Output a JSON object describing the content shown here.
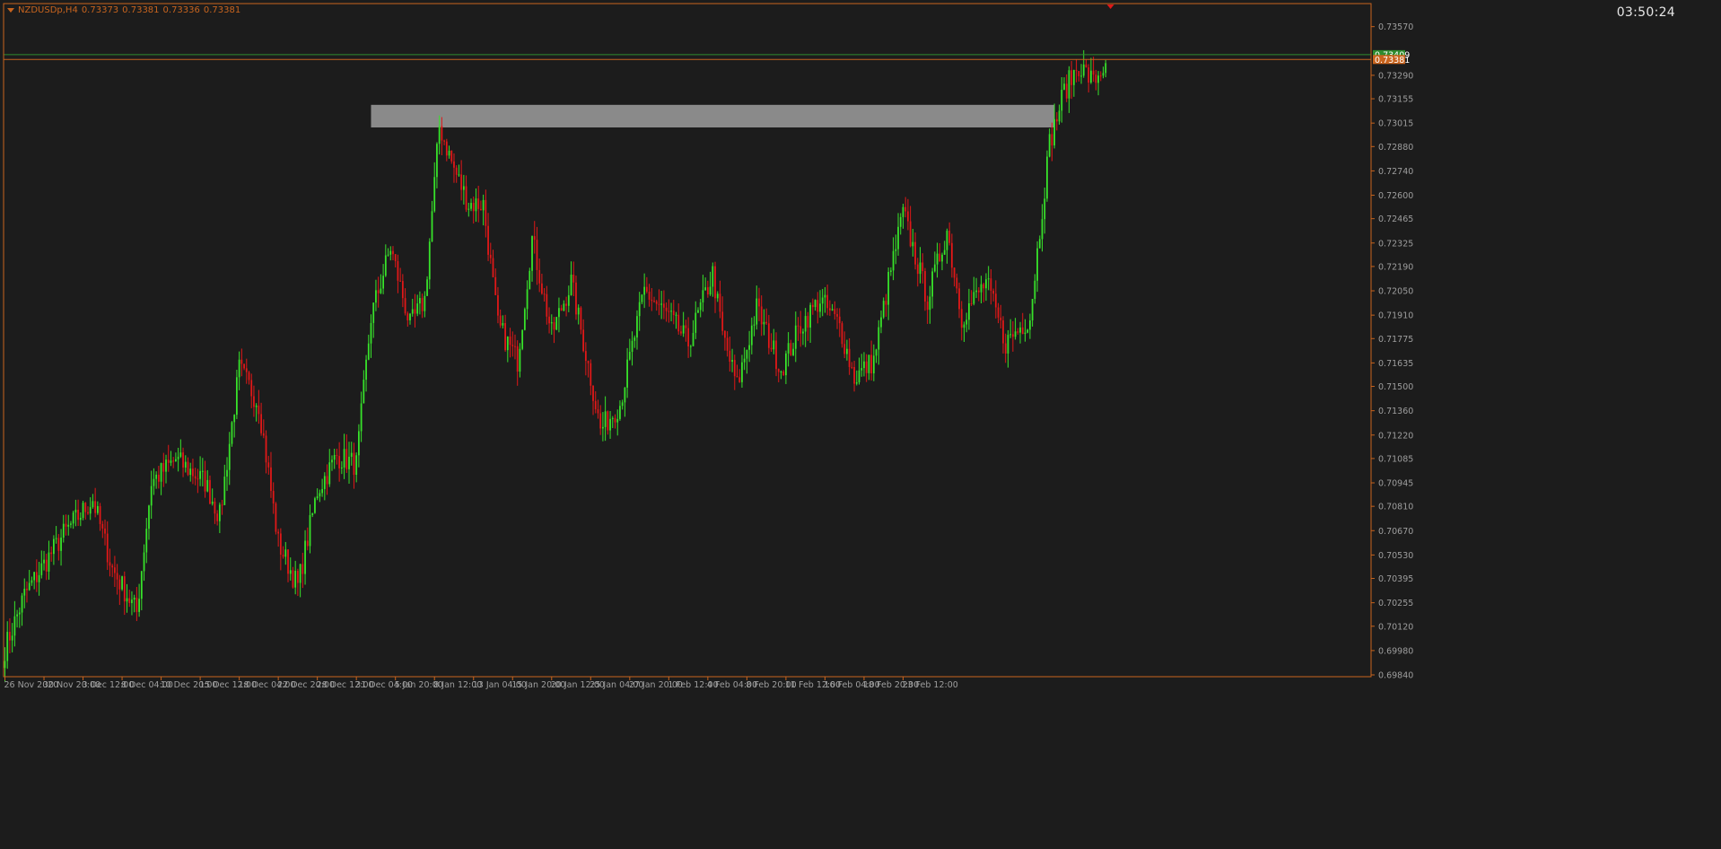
{
  "header": {
    "symbol": "NZDUSDp,H4",
    "ohlc": [
      "0.73373",
      "0.73381",
      "0.73336",
      "0.73381"
    ]
  },
  "clock": "03:50:24",
  "colors": {
    "background": "#1c1c1c",
    "axis": "#c8641e",
    "bull": "#37e22a",
    "bear": "#e01818",
    "zone": "#8a8a8a",
    "bid_line": "#c8641e",
    "ask_line": "#2e8b2e",
    "grid_text": "#9e9e9e"
  },
  "price_labels": {
    "ask": "0.73409",
    "bid": "0.73381"
  },
  "chart_data": {
    "type": "candlestick",
    "symbol": "NZDUSDp",
    "timeframe": "H4",
    "y_ticks": [
      "0.73570",
      "0.73290",
      "0.73155",
      "0.73015",
      "0.72880",
      "0.72740",
      "0.72600",
      "0.72465",
      "0.72325",
      "0.72190",
      "0.72050",
      "0.71910",
      "0.71775",
      "0.71635",
      "0.71500",
      "0.71360",
      "0.71220",
      "0.71085",
      "0.70945",
      "0.70810",
      "0.70670",
      "0.70530",
      "0.70395",
      "0.70255",
      "0.70120",
      "0.69980",
      "0.69840"
    ],
    "ylim": [
      0.6984,
      0.7362
    ],
    "x_ticks": [
      "26 Nov 2020",
      "30 Nov 20:00",
      "3 Dec 12:00",
      "8 Dec 04:00",
      "10 Dec 20:00",
      "15 Dec 12:00",
      "18 Dec 04:00",
      "22 Dec 20:00",
      "28 Dec 12:00",
      "31 Dec 04:00",
      "5 Jan 20:00",
      "8 Jan 12:00",
      "13 Jan 04:00",
      "15 Jan 20:00",
      "20 Jan 12:00",
      "25 Jan 04:00",
      "27 Jan 20:00",
      "1 Feb 12:00",
      "4 Feb 04:00",
      "8 Feb 20:00",
      "11 Feb 12:00",
      "16 Feb 04:00",
      "18 Feb 20:00",
      "23 Feb 12:00"
    ],
    "bars_per_tick": 16,
    "bid": 0.73381,
    "ask": 0.73409,
    "zone": {
      "start_bar": 150,
      "end_bar": 430,
      "low": 0.7299,
      "high": 0.7312
    },
    "key_points": [
      [
        0,
        0.6999
      ],
      [
        8,
        0.703
      ],
      [
        24,
        0.7065
      ],
      [
        36,
        0.7085
      ],
      [
        44,
        0.7045
      ],
      [
        54,
        0.702
      ],
      [
        60,
        0.7095
      ],
      [
        70,
        0.7108
      ],
      [
        82,
        0.7095
      ],
      [
        88,
        0.7075
      ],
      [
        96,
        0.716
      ],
      [
        104,
        0.714
      ],
      [
        112,
        0.706
      ],
      [
        120,
        0.7035
      ],
      [
        128,
        0.709
      ],
      [
        136,
        0.711
      ],
      [
        144,
        0.7105
      ],
      [
        150,
        0.719
      ],
      [
        158,
        0.723
      ],
      [
        166,
        0.7185
      ],
      [
        172,
        0.72
      ],
      [
        178,
        0.73
      ],
      [
        184,
        0.7275
      ],
      [
        190,
        0.7255
      ],
      [
        196,
        0.7255
      ],
      [
        202,
        0.7185
      ],
      [
        210,
        0.7165
      ],
      [
        216,
        0.7235
      ],
      [
        224,
        0.718
      ],
      [
        232,
        0.721
      ],
      [
        240,
        0.7155
      ],
      [
        244,
        0.7125
      ],
      [
        252,
        0.714
      ],
      [
        262,
        0.7205
      ],
      [
        272,
        0.719
      ],
      [
        280,
        0.7175
      ],
      [
        290,
        0.7215
      ],
      [
        294,
        0.718
      ],
      [
        300,
        0.715
      ],
      [
        308,
        0.7195
      ],
      [
        318,
        0.716
      ],
      [
        326,
        0.7185
      ],
      [
        334,
        0.72
      ],
      [
        342,
        0.7185
      ],
      [
        348,
        0.7155
      ],
      [
        356,
        0.7165
      ],
      [
        362,
        0.721
      ],
      [
        368,
        0.725
      ],
      [
        378,
        0.72
      ],
      [
        386,
        0.724
      ],
      [
        392,
        0.719
      ],
      [
        402,
        0.721
      ],
      [
        410,
        0.7175
      ],
      [
        420,
        0.719
      ],
      [
        428,
        0.729
      ],
      [
        434,
        0.732
      ],
      [
        440,
        0.7335
      ],
      [
        446,
        0.7325
      ],
      [
        451,
        0.7336
      ]
    ]
  }
}
